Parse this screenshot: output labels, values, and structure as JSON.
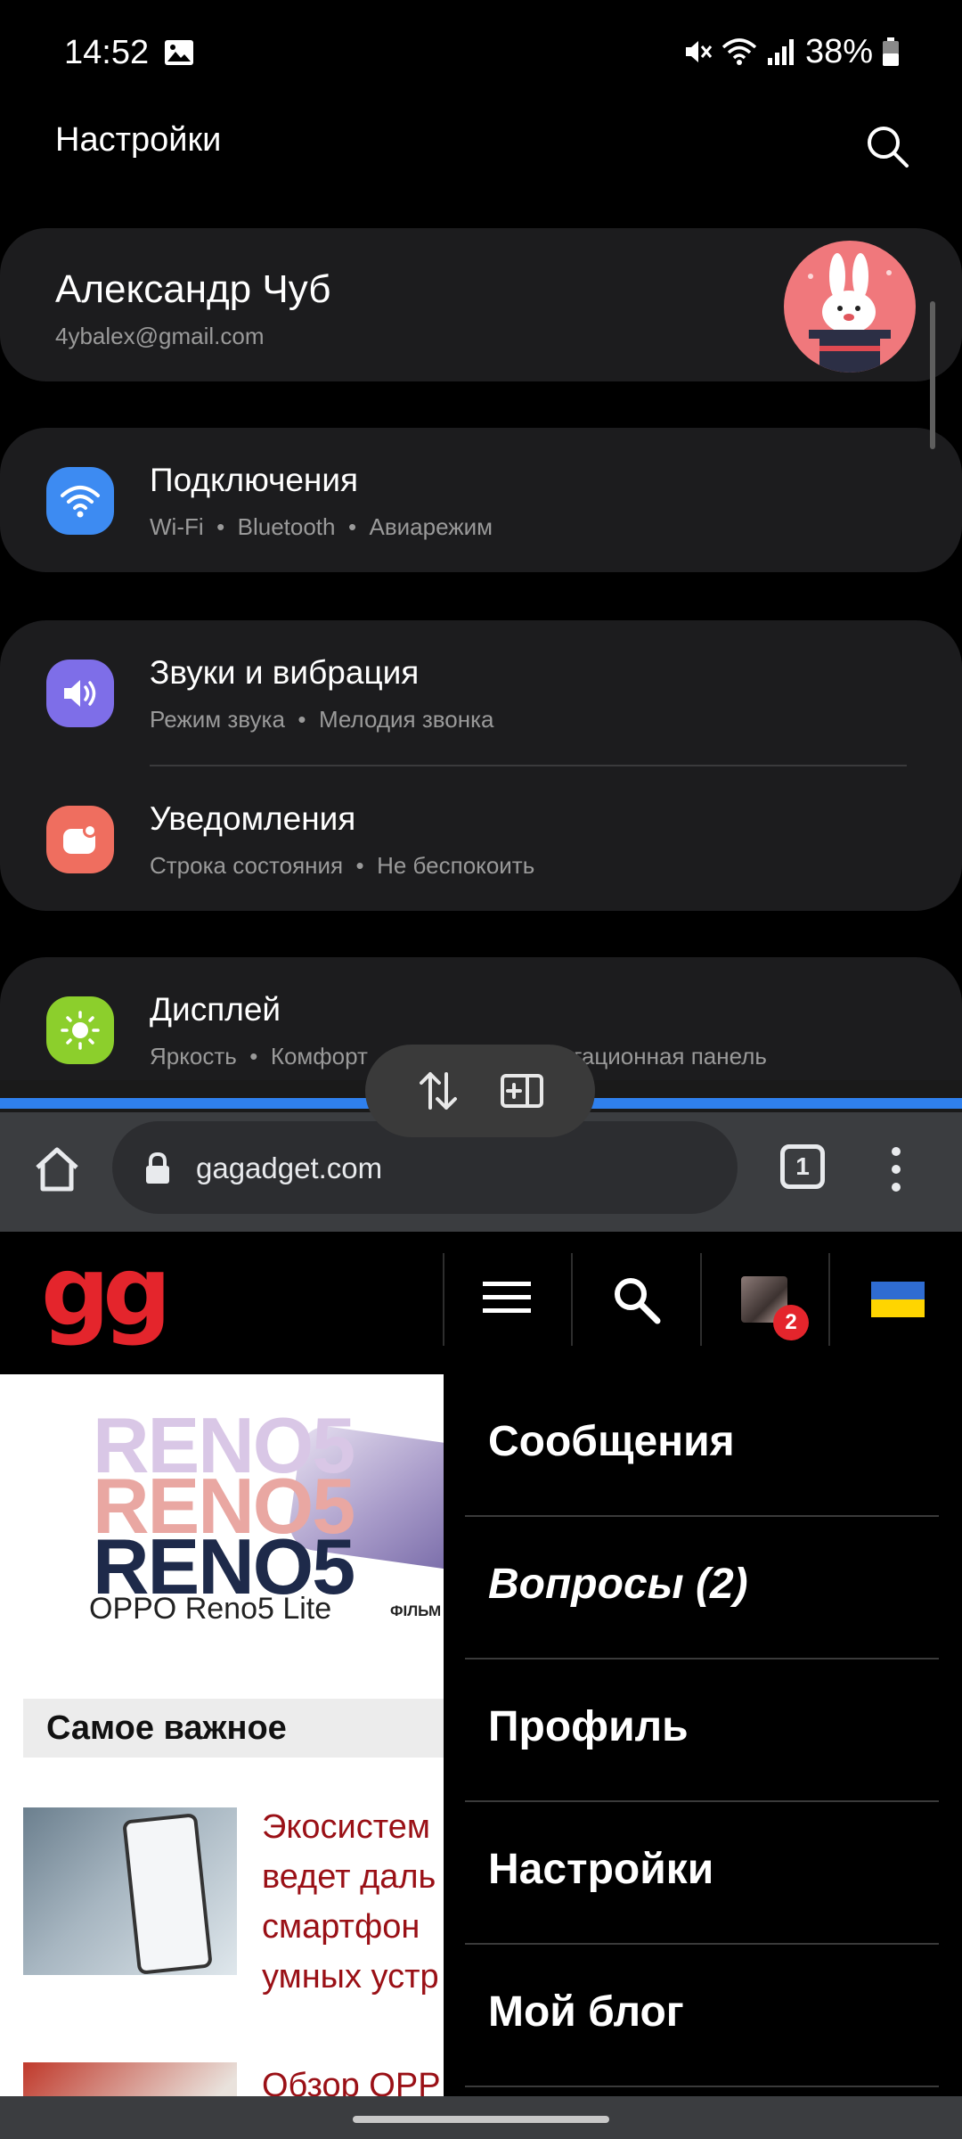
{
  "status_bar": {
    "time": "14:52",
    "battery": "38%",
    "icons": [
      "image-icon",
      "mute-icon",
      "wifi-icon",
      "signal-icon",
      "battery-icon"
    ]
  },
  "settings": {
    "title": "Настройки",
    "profile": {
      "name": "Александр Чуб",
      "email": "4ybalex@gmail.com"
    },
    "items": [
      {
        "title": "Подключения",
        "subtitle": "Wi-Fi  •  Bluetooth  •  Авиарежим",
        "icon": "wifi-icon",
        "color": "#3d8bf2"
      },
      {
        "title": "Звуки и вибрация",
        "subtitle": "Режим звука  •  Мелодия звонка",
        "icon": "volume-icon",
        "color": "#7e6ee8"
      },
      {
        "title": "Уведомления",
        "subtitle": "Строка состояния  •  Не беспокоить",
        "icon": "notification-icon",
        "color": "#ef6e5f"
      },
      {
        "title": "Дисплей",
        "subtitle_start": "Яркость  •  Комфорт",
        "subtitle_end": "гационная панель",
        "icon": "sun-icon",
        "color": "#8ccf2c"
      }
    ]
  },
  "browser": {
    "url": "gagadget.com",
    "tab_count": "1",
    "site": {
      "logo": "gg",
      "notification_count": "2",
      "ad": {
        "lines": [
          "RENO5",
          "RENO5",
          "RENO5"
        ],
        "caption": "OPPO Reno5 Lite",
        "caption_tail": "ФІЛЬМ"
      },
      "section_title": "Самое важное",
      "news": [
        {
          "lines": [
            "Экосистем",
            "ведет даль",
            "смартфон",
            "умных устр"
          ]
        },
        {
          "lines": [
            "Обзор OPP"
          ]
        }
      ],
      "menu": [
        {
          "label": "Сообщения",
          "italic": false
        },
        {
          "label": "Вопросы (2)",
          "italic": true
        },
        {
          "label": "Профиль",
          "italic": false
        },
        {
          "label": "Настройки",
          "italic": false
        },
        {
          "label": "Мой блог",
          "italic": false
        }
      ]
    }
  },
  "colors": {
    "accent_blue": "#2f80ed",
    "logo_red": "#e4252c",
    "news_red": "#9a1016"
  }
}
